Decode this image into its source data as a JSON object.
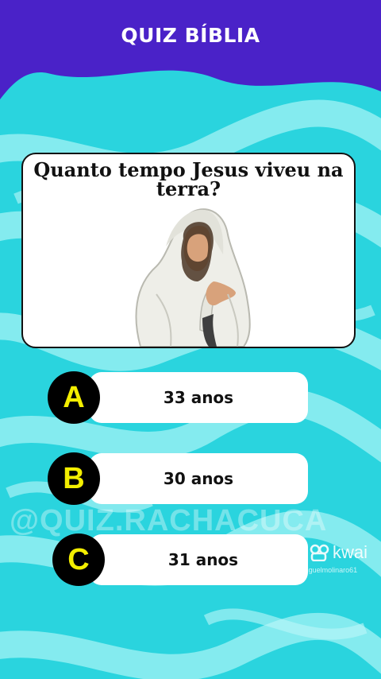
{
  "header": {
    "title": "QUIZ BÍBLIA"
  },
  "question": {
    "text": "Quanto tempo Jesus viveu na terra?"
  },
  "answers": [
    {
      "letter": "A",
      "text": "33 anos"
    },
    {
      "letter": "B",
      "text": "30 anos"
    },
    {
      "letter": "C",
      "text": "31 anos"
    }
  ],
  "watermark": {
    "handle": "@QUIZ.RACHACUCA"
  },
  "kwai": {
    "brand": "kwai",
    "user": "@miguelmolinaro61"
  },
  "colors": {
    "header": "#4a22c8",
    "background": "#2ad4de",
    "swirl": "#8ff0f4",
    "letter_bg": "#000000",
    "letter_fg": "#f3ee00"
  }
}
